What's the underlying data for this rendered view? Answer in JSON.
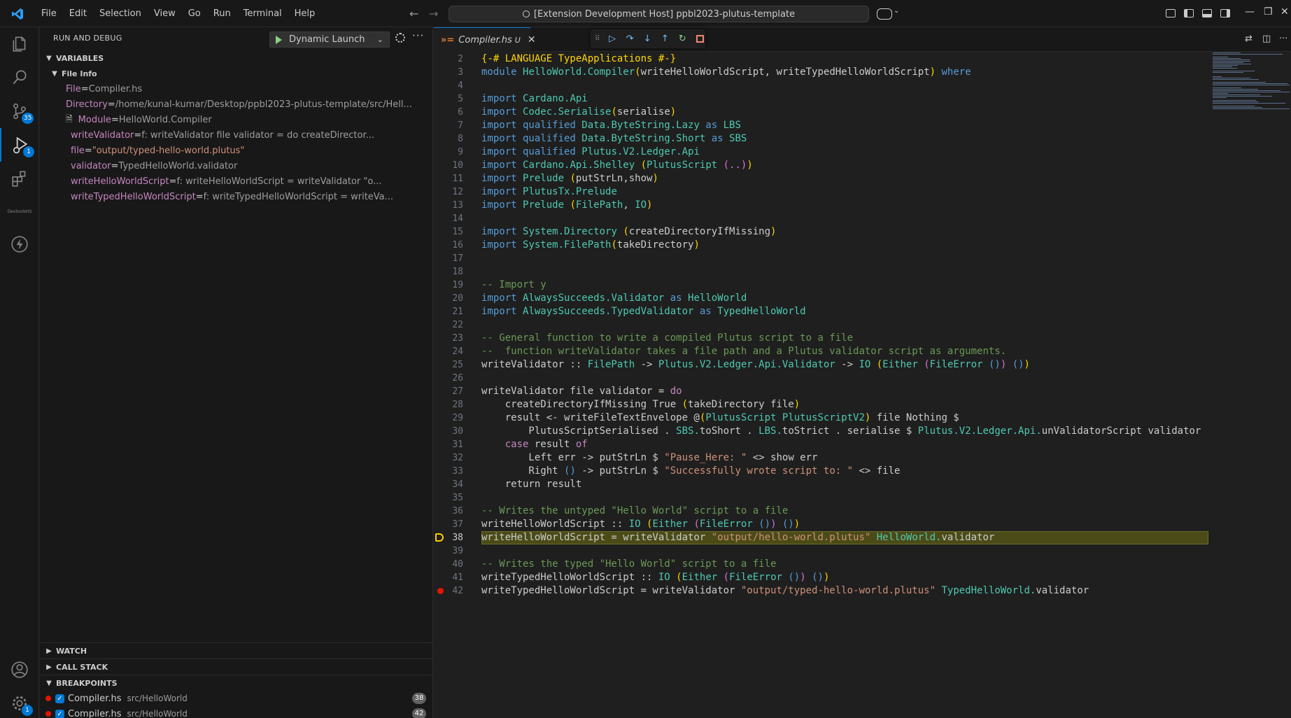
{
  "titlebar": {
    "menu": [
      "File",
      "Edit",
      "Selection",
      "View",
      "Go",
      "Run",
      "Terminal",
      "Help"
    ],
    "command_center": "[Extension Development Host] ppbl2023-plutus-template"
  },
  "activity": {
    "scm_badge": "35",
    "debug_badge": "1",
    "settings_badge": "1",
    "small_text": "DevtoolsHS"
  },
  "sidebar": {
    "title": "RUN AND DEBUG",
    "launch_config": "Dynamic Launch",
    "variables_title": "VARIABLES",
    "file_info_title": "File Info",
    "vars": [
      {
        "name": "File",
        "eq": " = ",
        "value": "Compiler.hs"
      },
      {
        "name": "Directory",
        "eq": " = ",
        "value": "/home/kunal-kumar/Desktop/ppbl2023-plutus-template/src/Hell..."
      },
      {
        "name": "Module",
        "eq": " = ",
        "value": "HelloWorld.Compiler"
      },
      {
        "name": "writeValidator",
        "eq": "  = ",
        "value": "f: writeValidator file validator = do createDirector..."
      },
      {
        "name": "file",
        "eq": "  = ",
        "value": "\"output/typed-hello-world.plutus\""
      },
      {
        "name": "validator",
        "eq": "  = ",
        "value": "TypedHelloWorld.validator"
      },
      {
        "name": "writeHelloWorldScript",
        "eq": "  = ",
        "value": "f: writeHelloWorldScript  = writeValidator \"o..."
      },
      {
        "name": "writeTypedHelloWorldScript",
        "eq": "  = ",
        "value": "f: writeTypedHelloWorldScript  = writeVa..."
      }
    ],
    "watch_title": "WATCH",
    "callstack_title": "CALL STACK",
    "breakpoints_title": "BREAKPOINTS",
    "breakpoints": [
      {
        "file": "Compiler.hs",
        "path": "src/HelloWorld",
        "line": "38"
      },
      {
        "file": "Compiler.hs",
        "path": "src/HelloWorld",
        "line": "42"
      }
    ]
  },
  "editor": {
    "tab_name": "Compiler.hs",
    "tab_status": "U",
    "current_line": "38",
    "breakpoint_line": "42",
    "lines": [
      {
        "n": "2",
        "segs": [
          [
            "pb",
            "{-# LANGUAGE TypeApplications #-}"
          ]
        ]
      },
      {
        "n": "3",
        "segs": [
          [
            "kw",
            "module "
          ],
          [
            "ty",
            "HelloWorld.Compiler"
          ],
          [
            "pb",
            "("
          ],
          [
            "",
            "writeHelloWorldScript, writeTypedHelloWorldScript"
          ],
          [
            "pb",
            ")"
          ],
          [
            "kw",
            " where"
          ]
        ]
      },
      {
        "n": "4",
        "segs": []
      },
      {
        "n": "5",
        "segs": [
          [
            "kw",
            "import "
          ],
          [
            "ty",
            "Cardano.Api"
          ]
        ]
      },
      {
        "n": "6",
        "segs": [
          [
            "kw",
            "import "
          ],
          [
            "ty",
            "Codec.Serialise"
          ],
          [
            "pb",
            "("
          ],
          [
            "",
            "serialise"
          ],
          [
            "pb",
            ")"
          ]
        ]
      },
      {
        "n": "7",
        "segs": [
          [
            "kw",
            "import qualified "
          ],
          [
            "ty",
            "Data.ByteString.Lazy"
          ],
          [
            "kw",
            " as "
          ],
          [
            "ty",
            "LBS"
          ]
        ]
      },
      {
        "n": "8",
        "segs": [
          [
            "kw",
            "import qualified "
          ],
          [
            "ty",
            "Data.ByteString.Short"
          ],
          [
            "kw",
            " as "
          ],
          [
            "ty",
            "SBS"
          ]
        ]
      },
      {
        "n": "9",
        "segs": [
          [
            "kw",
            "import qualified "
          ],
          [
            "ty",
            "Plutus.V2.Ledger.Api"
          ]
        ]
      },
      {
        "n": "10",
        "segs": [
          [
            "kw",
            "import "
          ],
          [
            "ty",
            "Cardano.Api.Shelley "
          ],
          [
            "pb",
            "("
          ],
          [
            "ty",
            "PlutusScript "
          ],
          [
            "pm",
            "(..)"
          ],
          [
            "pb",
            ")"
          ]
        ]
      },
      {
        "n": "11",
        "segs": [
          [
            "kw",
            "import "
          ],
          [
            "ty",
            "Prelude "
          ],
          [
            "pb",
            "("
          ],
          [
            "",
            "putStrLn,show"
          ],
          [
            "pb",
            ")"
          ]
        ]
      },
      {
        "n": "12",
        "segs": [
          [
            "kw",
            "import "
          ],
          [
            "ty",
            "PlutusTx.Prelude"
          ]
        ]
      },
      {
        "n": "13",
        "segs": [
          [
            "kw",
            "import "
          ],
          [
            "ty",
            "Prelude "
          ],
          [
            "pb",
            "("
          ],
          [
            "ty",
            "FilePath"
          ],
          [
            "",
            ", "
          ],
          [
            "ty",
            "IO"
          ],
          [
            "pb",
            ")"
          ]
        ]
      },
      {
        "n": "14",
        "segs": []
      },
      {
        "n": "15",
        "segs": [
          [
            "kw",
            "import "
          ],
          [
            "ty",
            "System.Directory "
          ],
          [
            "pb",
            "("
          ],
          [
            "",
            "createDirectoryIfMissing"
          ],
          [
            "pb",
            ")"
          ]
        ]
      },
      {
        "n": "16",
        "segs": [
          [
            "kw",
            "import "
          ],
          [
            "ty",
            "System.FilePath"
          ],
          [
            "pb",
            "("
          ],
          [
            "",
            "takeDirectory"
          ],
          [
            "pb",
            ")"
          ]
        ]
      },
      {
        "n": "17",
        "segs": []
      },
      {
        "n": "18",
        "segs": []
      },
      {
        "n": "19",
        "segs": [
          [
            "cm",
            "-- Import y"
          ]
        ]
      },
      {
        "n": "20",
        "segs": [
          [
            "kw",
            "import "
          ],
          [
            "ty",
            "AlwaysSucceeds.Validator"
          ],
          [
            "kw",
            " as "
          ],
          [
            "ty",
            "HelloWorld"
          ]
        ]
      },
      {
        "n": "21",
        "segs": [
          [
            "kw",
            "import "
          ],
          [
            "ty",
            "AlwaysSucceeds.TypedValidator"
          ],
          [
            "kw",
            " as "
          ],
          [
            "ty",
            "TypedHelloWorld"
          ]
        ]
      },
      {
        "n": "22",
        "segs": []
      },
      {
        "n": "23",
        "segs": [
          [
            "cm",
            "-- General function to write a compiled Plutus script to a file"
          ]
        ]
      },
      {
        "n": "24",
        "segs": [
          [
            "cm",
            "--  function writeValidator takes a file path and a Plutus validator script as arguments."
          ]
        ]
      },
      {
        "n": "25",
        "segs": [
          [
            "",
            "writeValidator :: "
          ],
          [
            "ty",
            "FilePath"
          ],
          [
            "",
            " -> "
          ],
          [
            "ty",
            "Plutus.V2.Ledger.Api.Validator"
          ],
          [
            "",
            " -> "
          ],
          [
            "ty",
            "IO "
          ],
          [
            "pb",
            "("
          ],
          [
            "ty",
            "Either "
          ],
          [
            "pm",
            "("
          ],
          [
            "ty",
            "FileError "
          ],
          [
            "kw",
            "()"
          ],
          [
            "pm",
            ")"
          ],
          [
            "",
            " "
          ],
          [
            "kw",
            "()"
          ],
          [
            "pb",
            ")"
          ]
        ]
      },
      {
        "n": "26",
        "segs": []
      },
      {
        "n": "27",
        "segs": [
          [
            "",
            "writeValidator file validator = "
          ],
          [
            "kwp",
            "do"
          ]
        ]
      },
      {
        "n": "28",
        "segs": [
          [
            "",
            "    createDirectoryIfMissing True "
          ],
          [
            "pb",
            "("
          ],
          [
            "",
            "takeDirectory file"
          ],
          [
            "pb",
            ")"
          ]
        ]
      },
      {
        "n": "29",
        "segs": [
          [
            "",
            "    result <- writeFileTextEnvelope @"
          ],
          [
            "pb",
            "("
          ],
          [
            "ty",
            "PlutusScript PlutusScriptV2"
          ],
          [
            "pb",
            ")"
          ],
          [
            "",
            " file Nothing $"
          ]
        ]
      },
      {
        "n": "30",
        "segs": [
          [
            "",
            "        PlutusScriptSerialised . "
          ],
          [
            "ty",
            "SBS."
          ],
          [
            "",
            "toShort . "
          ],
          [
            "ty",
            "LBS."
          ],
          [
            "",
            "toStrict . serialise $ "
          ],
          [
            "ty",
            "Plutus.V2.Ledger.Api."
          ],
          [
            "",
            "unValidatorScript validator"
          ]
        ]
      },
      {
        "n": "31",
        "segs": [
          [
            "",
            "    "
          ],
          [
            "kwp",
            "case"
          ],
          [
            "",
            " result "
          ],
          [
            "kwp",
            "of"
          ]
        ]
      },
      {
        "n": "32",
        "segs": [
          [
            "",
            "        Left err -> putStrLn $ "
          ],
          [
            "st",
            "\"Pause_Here: \""
          ],
          [
            "",
            " <> show err"
          ]
        ]
      },
      {
        "n": "33",
        "segs": [
          [
            "",
            "        Right "
          ],
          [
            "kw",
            "()"
          ],
          [
            "",
            " -> putStrLn $ "
          ],
          [
            "st",
            "\"Successfully wrote script to: \""
          ],
          [
            "",
            " <> file"
          ]
        ]
      },
      {
        "n": "34",
        "segs": [
          [
            "",
            "    return result"
          ]
        ]
      },
      {
        "n": "35",
        "segs": []
      },
      {
        "n": "36",
        "segs": [
          [
            "cm",
            "-- Writes the untyped \"Hello World\" script to a file"
          ]
        ]
      },
      {
        "n": "37",
        "segs": [
          [
            "",
            "writeHelloWorldScript :: "
          ],
          [
            "ty",
            "IO "
          ],
          [
            "pb",
            "("
          ],
          [
            "ty",
            "Either "
          ],
          [
            "pm",
            "("
          ],
          [
            "ty",
            "FileError "
          ],
          [
            "kw",
            "()"
          ],
          [
            "pm",
            ")"
          ],
          [
            "",
            " "
          ],
          [
            "kw",
            "()"
          ],
          [
            "pb",
            ")"
          ]
        ]
      },
      {
        "n": "38",
        "segs": [
          [
            "",
            "writeHelloWorldScript = writeValidator "
          ],
          [
            "st",
            "\"output/hello-world.plutus\""
          ],
          [
            "",
            " "
          ],
          [
            "ty",
            "HelloWorld."
          ],
          [
            "",
            "validator"
          ]
        ]
      },
      {
        "n": "39",
        "segs": []
      },
      {
        "n": "40",
        "segs": [
          [
            "cm",
            "-- Writes the typed \"Hello World\" script to a file"
          ]
        ]
      },
      {
        "n": "41",
        "segs": [
          [
            "",
            "writeTypedHelloWorldScript :: "
          ],
          [
            "ty",
            "IO "
          ],
          [
            "pb",
            "("
          ],
          [
            "ty",
            "Either "
          ],
          [
            "pm",
            "("
          ],
          [
            "ty",
            "FileError "
          ],
          [
            "kw",
            "()"
          ],
          [
            "pm",
            ")"
          ],
          [
            "",
            " "
          ],
          [
            "kw",
            "()"
          ],
          [
            "pb",
            ")"
          ]
        ]
      },
      {
        "n": "42",
        "segs": [
          [
            "",
            "writeTypedHelloWorldScript = writeValidator "
          ],
          [
            "st",
            "\"output/typed-hello-world.plutus\""
          ],
          [
            "",
            " "
          ],
          [
            "ty",
            "TypedHelloWorld."
          ],
          [
            "",
            "validator"
          ]
        ]
      }
    ]
  }
}
